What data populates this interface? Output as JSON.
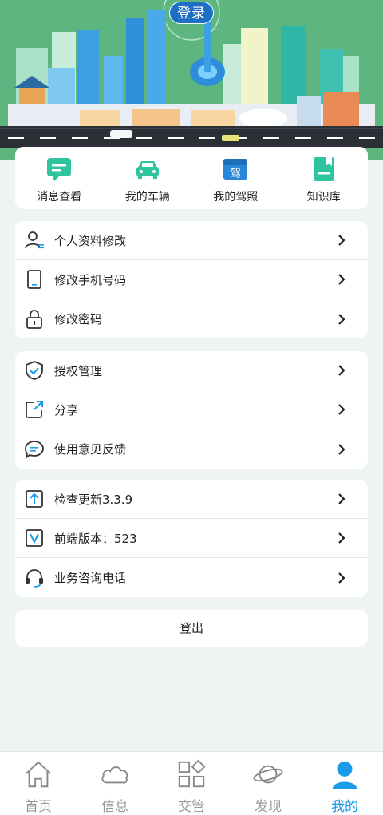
{
  "header": {
    "login_label": "登录"
  },
  "quick_menu": [
    {
      "label": "消息查看",
      "icon": "message-icon"
    },
    {
      "label": "我的车辆",
      "icon": "car-icon"
    },
    {
      "label": "我的驾照",
      "icon": "license-icon"
    },
    {
      "label": "知识库",
      "icon": "book-icon"
    }
  ],
  "group1": [
    {
      "label": "个人资料修改",
      "icon": "profile-icon"
    },
    {
      "label": "修改手机号码",
      "icon": "phone-icon"
    },
    {
      "label": "修改密码",
      "icon": "lock-icon"
    }
  ],
  "group2": [
    {
      "label": "授权管理",
      "icon": "shield-icon"
    },
    {
      "label": "分享",
      "icon": "share-icon"
    },
    {
      "label": "使用意见反馈",
      "icon": "feedback-icon"
    }
  ],
  "group3": [
    {
      "label": "检查更新3.3.9",
      "icon": "update-icon"
    },
    {
      "label": "前端版本：523",
      "icon": "version-icon"
    },
    {
      "label": "业务咨询电话",
      "icon": "headset-icon"
    }
  ],
  "logout_label": "登出",
  "tabs": [
    {
      "label": "首页",
      "icon": "home-icon"
    },
    {
      "label": "信息",
      "icon": "cloud-icon"
    },
    {
      "label": "交管",
      "icon": "grid-icon"
    },
    {
      "label": "发现",
      "icon": "planet-icon"
    },
    {
      "label": "我的",
      "icon": "user-icon",
      "active": true
    }
  ],
  "colors": {
    "accent": "#1c9be8",
    "banner": "#58b47c",
    "quick_icon": "#2ec4a0"
  }
}
